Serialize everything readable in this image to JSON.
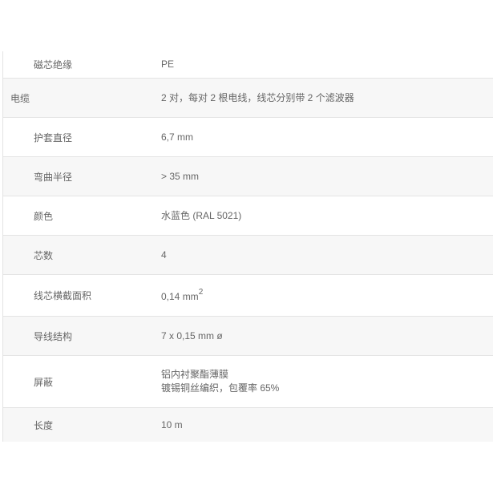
{
  "rows": [
    {
      "label": "磁芯绝缘",
      "value": "PE"
    },
    {
      "label": "电缆",
      "value": "2 对，每对 2 根电线，线芯分别带 2 个滤波器"
    },
    {
      "label": "护套直径",
      "value": "6,7 mm"
    },
    {
      "label": "弯曲半径",
      "value": "> 35 mm"
    },
    {
      "label": "颜色",
      "value": "水蓝色 (RAL 5021)"
    },
    {
      "label": "芯数",
      "value": "4"
    },
    {
      "label": "线芯横截面积",
      "value": "0,14 mm",
      "value_sup": "2"
    },
    {
      "label": "导线结构",
      "value": "7 x 0,15 mm ø"
    },
    {
      "label": "屏蔽",
      "value_line1": "铝内衬聚酯薄膜",
      "value_line2": "镀锡铜丝编织，包覆率 65%"
    },
    {
      "label": "长度",
      "value": "10 m"
    }
  ]
}
